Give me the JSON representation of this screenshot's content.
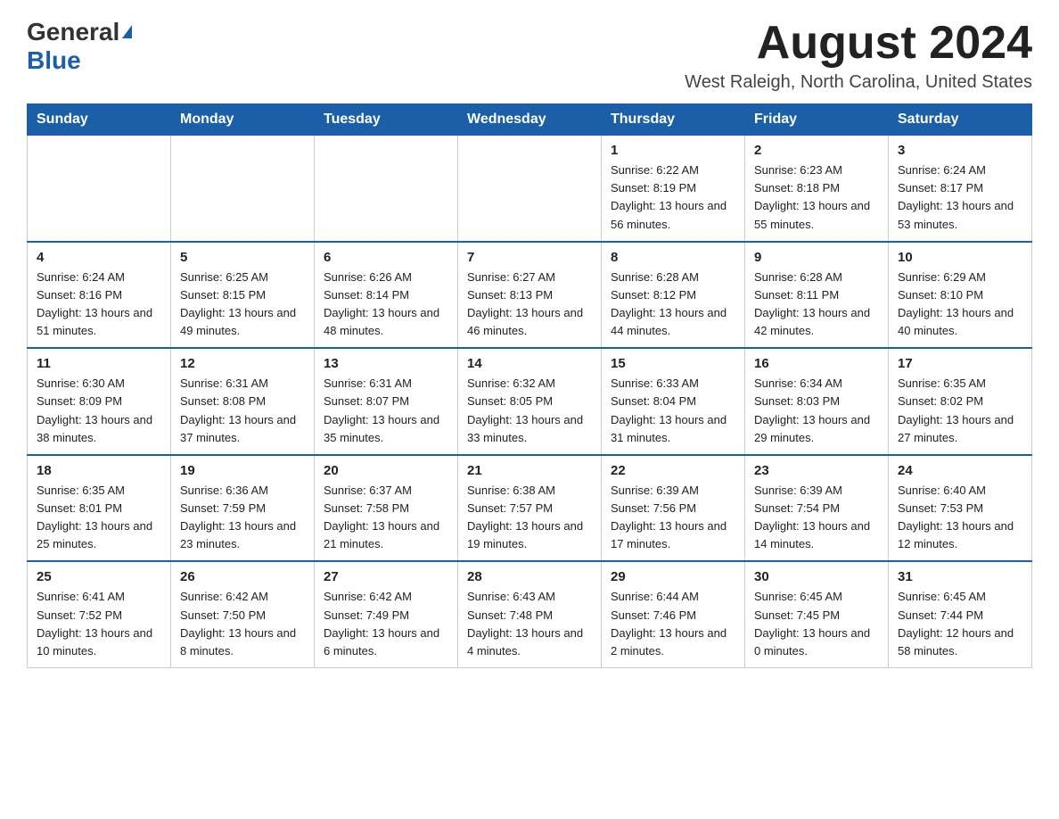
{
  "logo": {
    "general": "General",
    "blue": "Blue",
    "tagline": "GeneralBlue"
  },
  "header": {
    "month_year": "August 2024",
    "location": "West Raleigh, North Carolina, United States"
  },
  "days_of_week": [
    "Sunday",
    "Monday",
    "Tuesday",
    "Wednesday",
    "Thursday",
    "Friday",
    "Saturday"
  ],
  "weeks": [
    [
      {
        "day": "",
        "info": ""
      },
      {
        "day": "",
        "info": ""
      },
      {
        "day": "",
        "info": ""
      },
      {
        "day": "",
        "info": ""
      },
      {
        "day": "1",
        "info": "Sunrise: 6:22 AM\nSunset: 8:19 PM\nDaylight: 13 hours and 56 minutes."
      },
      {
        "day": "2",
        "info": "Sunrise: 6:23 AM\nSunset: 8:18 PM\nDaylight: 13 hours and 55 minutes."
      },
      {
        "day": "3",
        "info": "Sunrise: 6:24 AM\nSunset: 8:17 PM\nDaylight: 13 hours and 53 minutes."
      }
    ],
    [
      {
        "day": "4",
        "info": "Sunrise: 6:24 AM\nSunset: 8:16 PM\nDaylight: 13 hours and 51 minutes."
      },
      {
        "day": "5",
        "info": "Sunrise: 6:25 AM\nSunset: 8:15 PM\nDaylight: 13 hours and 49 minutes."
      },
      {
        "day": "6",
        "info": "Sunrise: 6:26 AM\nSunset: 8:14 PM\nDaylight: 13 hours and 48 minutes."
      },
      {
        "day": "7",
        "info": "Sunrise: 6:27 AM\nSunset: 8:13 PM\nDaylight: 13 hours and 46 minutes."
      },
      {
        "day": "8",
        "info": "Sunrise: 6:28 AM\nSunset: 8:12 PM\nDaylight: 13 hours and 44 minutes."
      },
      {
        "day": "9",
        "info": "Sunrise: 6:28 AM\nSunset: 8:11 PM\nDaylight: 13 hours and 42 minutes."
      },
      {
        "day": "10",
        "info": "Sunrise: 6:29 AM\nSunset: 8:10 PM\nDaylight: 13 hours and 40 minutes."
      }
    ],
    [
      {
        "day": "11",
        "info": "Sunrise: 6:30 AM\nSunset: 8:09 PM\nDaylight: 13 hours and 38 minutes."
      },
      {
        "day": "12",
        "info": "Sunrise: 6:31 AM\nSunset: 8:08 PM\nDaylight: 13 hours and 37 minutes."
      },
      {
        "day": "13",
        "info": "Sunrise: 6:31 AM\nSunset: 8:07 PM\nDaylight: 13 hours and 35 minutes."
      },
      {
        "day": "14",
        "info": "Sunrise: 6:32 AM\nSunset: 8:05 PM\nDaylight: 13 hours and 33 minutes."
      },
      {
        "day": "15",
        "info": "Sunrise: 6:33 AM\nSunset: 8:04 PM\nDaylight: 13 hours and 31 minutes."
      },
      {
        "day": "16",
        "info": "Sunrise: 6:34 AM\nSunset: 8:03 PM\nDaylight: 13 hours and 29 minutes."
      },
      {
        "day": "17",
        "info": "Sunrise: 6:35 AM\nSunset: 8:02 PM\nDaylight: 13 hours and 27 minutes."
      }
    ],
    [
      {
        "day": "18",
        "info": "Sunrise: 6:35 AM\nSunset: 8:01 PM\nDaylight: 13 hours and 25 minutes."
      },
      {
        "day": "19",
        "info": "Sunrise: 6:36 AM\nSunset: 7:59 PM\nDaylight: 13 hours and 23 minutes."
      },
      {
        "day": "20",
        "info": "Sunrise: 6:37 AM\nSunset: 7:58 PM\nDaylight: 13 hours and 21 minutes."
      },
      {
        "day": "21",
        "info": "Sunrise: 6:38 AM\nSunset: 7:57 PM\nDaylight: 13 hours and 19 minutes."
      },
      {
        "day": "22",
        "info": "Sunrise: 6:39 AM\nSunset: 7:56 PM\nDaylight: 13 hours and 17 minutes."
      },
      {
        "day": "23",
        "info": "Sunrise: 6:39 AM\nSunset: 7:54 PM\nDaylight: 13 hours and 14 minutes."
      },
      {
        "day": "24",
        "info": "Sunrise: 6:40 AM\nSunset: 7:53 PM\nDaylight: 13 hours and 12 minutes."
      }
    ],
    [
      {
        "day": "25",
        "info": "Sunrise: 6:41 AM\nSunset: 7:52 PM\nDaylight: 13 hours and 10 minutes."
      },
      {
        "day": "26",
        "info": "Sunrise: 6:42 AM\nSunset: 7:50 PM\nDaylight: 13 hours and 8 minutes."
      },
      {
        "day": "27",
        "info": "Sunrise: 6:42 AM\nSunset: 7:49 PM\nDaylight: 13 hours and 6 minutes."
      },
      {
        "day": "28",
        "info": "Sunrise: 6:43 AM\nSunset: 7:48 PM\nDaylight: 13 hours and 4 minutes."
      },
      {
        "day": "29",
        "info": "Sunrise: 6:44 AM\nSunset: 7:46 PM\nDaylight: 13 hours and 2 minutes."
      },
      {
        "day": "30",
        "info": "Sunrise: 6:45 AM\nSunset: 7:45 PM\nDaylight: 13 hours and 0 minutes."
      },
      {
        "day": "31",
        "info": "Sunrise: 6:45 AM\nSunset: 7:44 PM\nDaylight: 12 hours and 58 minutes."
      }
    ]
  ]
}
